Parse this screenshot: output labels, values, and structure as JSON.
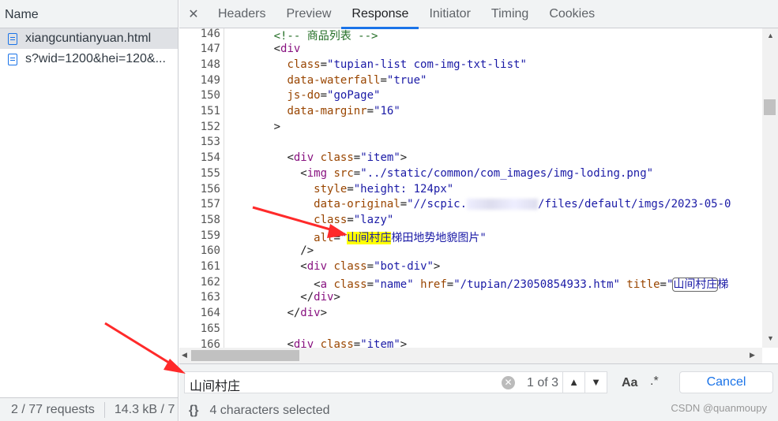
{
  "requests": {
    "header": "Name",
    "items": [
      {
        "name": "xiangcuntianyuan.html",
        "selected": true
      },
      {
        "name": "s?wid=1200&hei=120&..."
      }
    ],
    "status": {
      "requests": "2 / 77 requests",
      "size": "14.3 kB / 7"
    }
  },
  "tabs": {
    "close": "✕",
    "items": [
      "Headers",
      "Preview",
      "Response",
      "Initiator",
      "Timing",
      "Cookies"
    ],
    "active": "Response"
  },
  "code": {
    "lines": [
      {
        "n": "146",
        "indent": 6,
        "tokens": [
          [
            "com",
            "<!-- 商品列表 -->"
          ]
        ]
      },
      {
        "n": "147",
        "indent": 6,
        "tokens": [
          [
            "p",
            "<"
          ],
          [
            "tag",
            "div"
          ]
        ]
      },
      {
        "n": "148",
        "indent": 8,
        "tokens": [
          [
            "attr",
            "class"
          ],
          [
            "p",
            "="
          ],
          [
            "val",
            "\"tupian-list com-img-txt-list\""
          ]
        ]
      },
      {
        "n": "149",
        "indent": 8,
        "tokens": [
          [
            "attr",
            "data-waterfall"
          ],
          [
            "p",
            "="
          ],
          [
            "val",
            "\"true\""
          ]
        ]
      },
      {
        "n": "150",
        "indent": 8,
        "tokens": [
          [
            "attr",
            "js-do"
          ],
          [
            "p",
            "="
          ],
          [
            "val",
            "\"goPage\""
          ]
        ]
      },
      {
        "n": "151",
        "indent": 8,
        "tokens": [
          [
            "attr",
            "data-marginr"
          ],
          [
            "p",
            "="
          ],
          [
            "val",
            "\"16\""
          ]
        ]
      },
      {
        "n": "152",
        "indent": 6,
        "tokens": [
          [
            "p",
            ">"
          ]
        ]
      },
      {
        "n": "153",
        "indent": 0,
        "tokens": []
      },
      {
        "n": "154",
        "indent": 8,
        "tokens": [
          [
            "p",
            "<"
          ],
          [
            "tag",
            "div"
          ],
          [
            "p",
            " "
          ],
          [
            "attr",
            "class"
          ],
          [
            "p",
            "="
          ],
          [
            "val",
            "\"item\""
          ],
          [
            "p",
            ">"
          ]
        ]
      },
      {
        "n": "155",
        "indent": 10,
        "tokens": [
          [
            "p",
            "<"
          ],
          [
            "tag",
            "img"
          ],
          [
            "p",
            " "
          ],
          [
            "attr",
            "src"
          ],
          [
            "p",
            "="
          ],
          [
            "val",
            "\"../static/common/com_images/img-loding.png\""
          ]
        ]
      },
      {
        "n": "156",
        "indent": 12,
        "tokens": [
          [
            "attr",
            "style"
          ],
          [
            "p",
            "="
          ],
          [
            "val",
            "\"height: 124px\""
          ]
        ]
      },
      {
        "n": "157",
        "indent": 12,
        "tokens": [
          [
            "attr",
            "data-original"
          ],
          [
            "p",
            "="
          ],
          [
            "val",
            "\"//scpic."
          ],
          [
            "blur",
            ""
          ],
          [
            "val",
            "/files/default/imgs/2023-05-0"
          ]
        ]
      },
      {
        "n": "158",
        "indent": 12,
        "tokens": [
          [
            "attr",
            "class"
          ],
          [
            "p",
            "="
          ],
          [
            "val",
            "\"lazy\""
          ]
        ]
      },
      {
        "n": "159",
        "indent": 12,
        "tokens": [
          [
            "attr",
            "alt"
          ],
          [
            "p",
            "="
          ],
          [
            "val",
            "\""
          ],
          [
            "hl",
            "山间村庄"
          ],
          [
            "val",
            "梯田地势地貌图片\""
          ]
        ]
      },
      {
        "n": "160",
        "indent": 10,
        "tokens": [
          [
            "p",
            "/>"
          ]
        ]
      },
      {
        "n": "161",
        "indent": 10,
        "tokens": [
          [
            "p",
            "<"
          ],
          [
            "tag",
            "div"
          ],
          [
            "p",
            " "
          ],
          [
            "attr",
            "class"
          ],
          [
            "p",
            "="
          ],
          [
            "val",
            "\"bot-div\""
          ],
          [
            "p",
            ">"
          ]
        ]
      },
      {
        "n": "162",
        "indent": 12,
        "tokens": [
          [
            "p",
            "<"
          ],
          [
            "tag",
            "a"
          ],
          [
            "p",
            " "
          ],
          [
            "attr",
            "class"
          ],
          [
            "p",
            "="
          ],
          [
            "val",
            "\"name\""
          ],
          [
            "p",
            " "
          ],
          [
            "attr",
            "href"
          ],
          [
            "p",
            "="
          ],
          [
            "val",
            "\"/tupian/23050854933.htm\""
          ],
          [
            "p",
            " "
          ],
          [
            "attr",
            "title"
          ],
          [
            "p",
            "="
          ],
          [
            "val",
            "\""
          ],
          [
            "hl2",
            "山间村庄"
          ],
          [
            "val",
            "梯"
          ]
        ]
      },
      {
        "n": "163",
        "indent": 10,
        "tokens": [
          [
            "p",
            "</"
          ],
          [
            "tag",
            "div"
          ],
          [
            "p",
            ">"
          ]
        ]
      },
      {
        "n": "164",
        "indent": 8,
        "tokens": [
          [
            "p",
            "</"
          ],
          [
            "tag",
            "div"
          ],
          [
            "p",
            ">"
          ]
        ]
      },
      {
        "n": "165",
        "indent": 0,
        "tokens": []
      },
      {
        "n": "166",
        "indent": 8,
        "tokens": [
          [
            "p",
            "<"
          ],
          [
            "tag",
            "div"
          ],
          [
            "p",
            " "
          ],
          [
            "attr",
            "class"
          ],
          [
            "p",
            "="
          ],
          [
            "val",
            "\"item\""
          ],
          [
            "p",
            ">"
          ]
        ]
      }
    ]
  },
  "search": {
    "value": "山间村庄",
    "count": "1 of 3",
    "prev": "⌃",
    "next": "⌄",
    "match_case": "Aa",
    "regex": ".*",
    "cancel": "Cancel"
  },
  "bottom": {
    "pretty_print": "{}",
    "status": "4 characters selected"
  },
  "watermark": "CSDN @quanmoupy",
  "colors": {
    "accent": "#1a73e8",
    "highlight": "#ffff00",
    "arrow": "#ff2a2a"
  }
}
